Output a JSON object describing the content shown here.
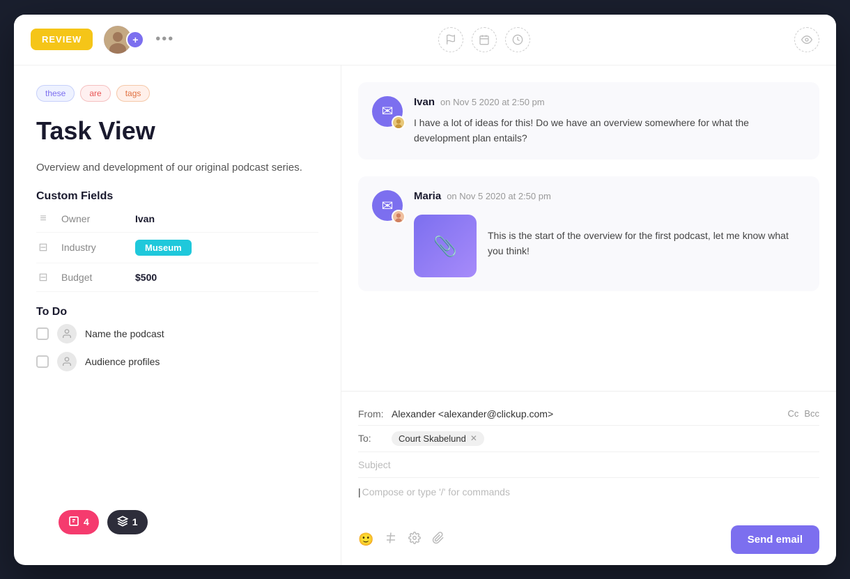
{
  "window": {
    "title": "Task View"
  },
  "header": {
    "status_badge": "REVIEW",
    "more_dots": "•••",
    "add_icon": "+",
    "toolbar_icons": [
      "flag-icon",
      "calendar-icon",
      "clock-icon"
    ],
    "eye_icon": "eye-icon"
  },
  "tags": [
    {
      "label": "these",
      "class": "tag-these"
    },
    {
      "label": "are",
      "class": "tag-are"
    },
    {
      "label": "tags",
      "class": "tag-tags"
    }
  ],
  "task": {
    "title": "Task View",
    "description": "Overview and development of our original podcast series."
  },
  "custom_fields": {
    "section_title": "Custom Fields",
    "fields": [
      {
        "icon": "≡",
        "label": "Owner",
        "value": "Ivan",
        "type": "text"
      },
      {
        "icon": "⊟",
        "label": "Industry",
        "value": "Museum",
        "type": "badge"
      },
      {
        "icon": "⊟",
        "label": "Budget",
        "value": "$500",
        "type": "text"
      }
    ]
  },
  "todo": {
    "section_title": "To Do",
    "items": [
      {
        "label": "Name the podcast"
      },
      {
        "label": "Audience profiles"
      }
    ]
  },
  "bottom_badges": [
    {
      "icon": "🔷",
      "count": "4",
      "class": "badge-red"
    },
    {
      "icon": "🔲",
      "count": "1",
      "class": "badge-dark"
    }
  ],
  "comments": [
    {
      "author": "Ivan",
      "time": "on Nov 5 2020 at 2:50 pm",
      "text": "I have a lot of ideas for this! Do we have an overview somewhere for what the development plan entails?",
      "has_attachment": false
    },
    {
      "author": "Maria",
      "time": "on Nov 5 2020 at 2:50 pm",
      "text": "This is the start of the overview for the first podcast, let me know what you think!",
      "has_attachment": true
    }
  ],
  "email": {
    "from_label": "From:",
    "from_value": "Alexander <alexander@clickup.com>",
    "cc_label": "Cc",
    "bcc_label": "Bcc",
    "to_label": "To:",
    "to_recipient": "Court Skabelund",
    "subject_placeholder": "Subject",
    "compose_placeholder": "Compose or type '/' for commands",
    "send_button": "Send email"
  }
}
